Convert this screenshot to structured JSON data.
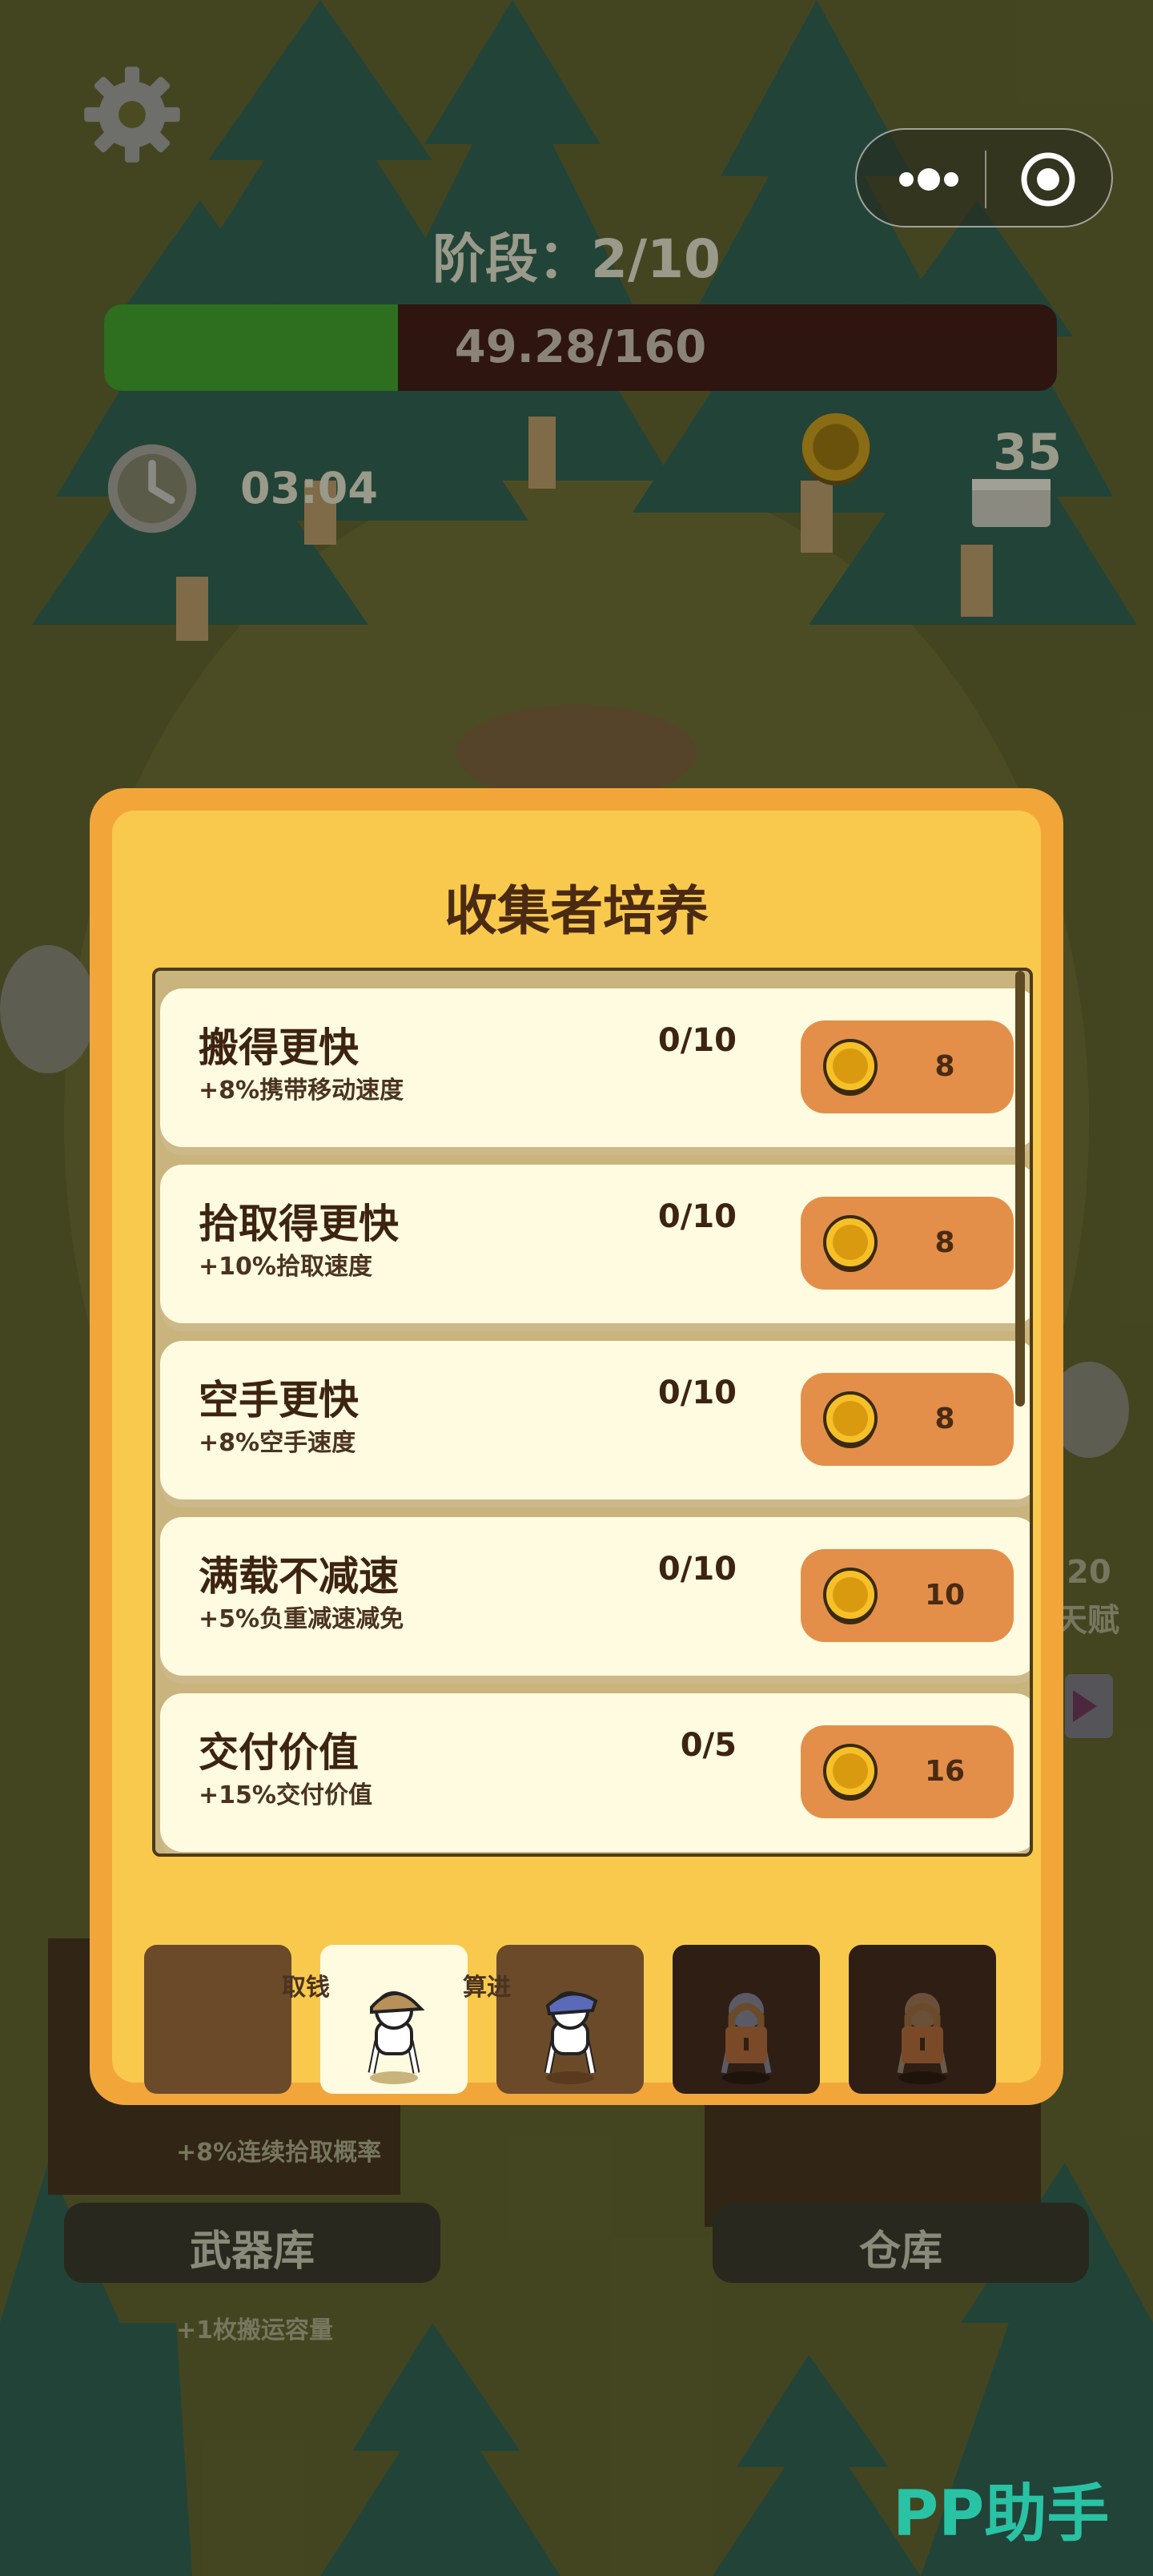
{
  "hud": {
    "stage_label": "阶段：2/10",
    "progress_text": "49.28/160",
    "progress_fraction": 0.308,
    "timer": "03:04",
    "wood_count": "35"
  },
  "background": {
    "talent_fragment_top": "20",
    "talent_fragment_bottom": "天赋",
    "pickup_bonus": "+8%连续拾取概率",
    "armory_label": "武器库",
    "warehouse_label": "仓库",
    "carry_bonus": "+1枚搬运容量",
    "hidden_text_a": "取钱",
    "hidden_text_b": "算进"
  },
  "modal": {
    "title": "收集者培养",
    "upgrades": [
      {
        "name": "搬得更快",
        "desc": "+8%携带移动速度",
        "level": "0/10",
        "price": "8"
      },
      {
        "name": "拾取得更快",
        "desc": "+10%拾取速度",
        "level": "0/10",
        "price": "8"
      },
      {
        "name": "空手更快",
        "desc": "+8%空手速度",
        "level": "0/10",
        "price": "8"
      },
      {
        "name": "满载不减速",
        "desc": "+5%负重减速减免",
        "level": "0/10",
        "price": "10"
      },
      {
        "name": "交付价值",
        "desc": "+15%交付价值",
        "level": "0/5",
        "price": "16"
      }
    ]
  },
  "watermark": "PP助手",
  "colors": {
    "panel_outer": "#f2a63a",
    "panel_inner": "#f9c94d",
    "card_bg": "#fffbe0",
    "buy_button": "#e38f4a",
    "progress_fill": "#2d6e1f",
    "watermark": "#29c2a4"
  }
}
